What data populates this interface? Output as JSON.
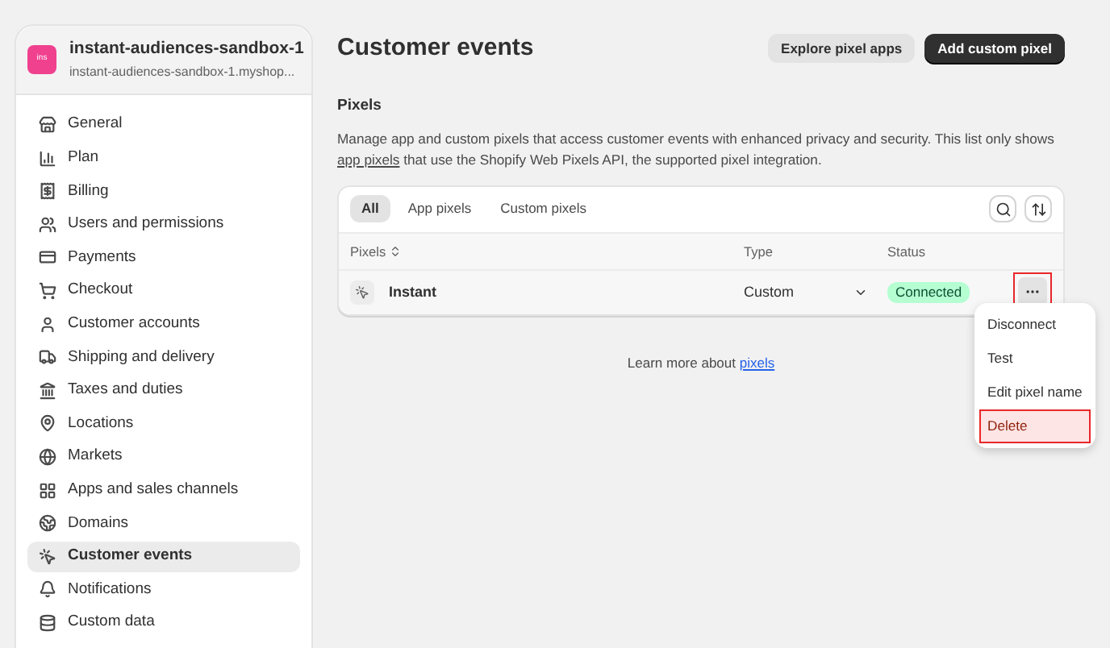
{
  "store": {
    "avatar": "ins",
    "name": "instant-audiences-sandbox-1",
    "domain": "instant-audiences-sandbox-1.myshop..."
  },
  "sidebar": {
    "items": [
      {
        "label": "General",
        "selected": false
      },
      {
        "label": "Plan",
        "selected": false
      },
      {
        "label": "Billing",
        "selected": false
      },
      {
        "label": "Users and permissions",
        "selected": false
      },
      {
        "label": "Payments",
        "selected": false
      },
      {
        "label": "Checkout",
        "selected": false
      },
      {
        "label": "Customer accounts",
        "selected": false
      },
      {
        "label": "Shipping and delivery",
        "selected": false
      },
      {
        "label": "Taxes and duties",
        "selected": false
      },
      {
        "label": "Locations",
        "selected": false
      },
      {
        "label": "Markets",
        "selected": false
      },
      {
        "label": "Apps and sales channels",
        "selected": false
      },
      {
        "label": "Domains",
        "selected": false
      },
      {
        "label": "Customer events",
        "selected": true
      },
      {
        "label": "Notifications",
        "selected": false
      },
      {
        "label": "Custom data",
        "selected": false
      }
    ]
  },
  "page": {
    "title": "Customer events",
    "buttons": [
      {
        "label": "Explore pixel apps",
        "kind": "secondary"
      },
      {
        "label": "Add custom pixel",
        "kind": "primary"
      }
    ]
  },
  "section": {
    "title": "Pixels",
    "description_before": "Manage app and custom pixels that access customer events with enhanced privacy and security. This list only shows",
    "description_link": "app pixels",
    "description_after": "that use the Shopify Web Pixels API, the supported pixel integration."
  },
  "tabs": [
    {
      "label": "All",
      "selected": true
    },
    {
      "label": "App pixels",
      "selected": false
    },
    {
      "label": "Custom pixels",
      "selected": false
    }
  ],
  "table": {
    "columns": [
      "Pixels",
      "Type",
      "Status"
    ],
    "rows": [
      {
        "name": "Instant",
        "type": "Custom",
        "status": "Connected",
        "menu_highlighted": true
      }
    ]
  },
  "footer": {
    "text": "Learn more about",
    "link": "pixels"
  },
  "menu": {
    "items": [
      {
        "label": "Disconnect",
        "kind": "normal",
        "highlighted": false
      },
      {
        "label": "Test",
        "kind": "normal",
        "highlighted": false
      },
      {
        "label": "Edit pixel name",
        "kind": "normal",
        "highlighted": false
      },
      {
        "label": "Delete",
        "kind": "destructive",
        "highlighted": true
      }
    ]
  }
}
